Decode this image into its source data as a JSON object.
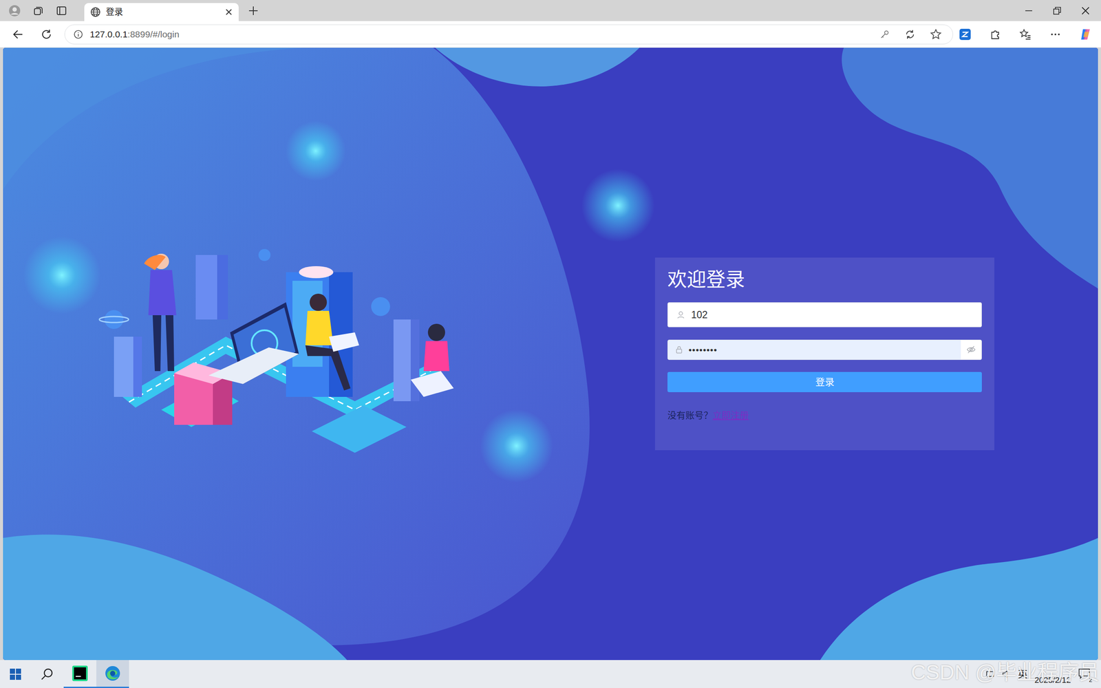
{
  "browser": {
    "tab": {
      "title": "登录"
    },
    "address": {
      "host": "127.0.0.1",
      "rest": ":8899/#/login"
    }
  },
  "login": {
    "title": "欢迎登录",
    "username": {
      "value": "102"
    },
    "password": {
      "value": "••••••••"
    },
    "submit": "登录",
    "register_prompt": "没有账号？",
    "register_link": "立即注册"
  },
  "taskbar": {
    "ime": "英",
    "date": "2025/2/12",
    "notifications": "2"
  },
  "watermark": "CSDN @毕业程序员"
}
